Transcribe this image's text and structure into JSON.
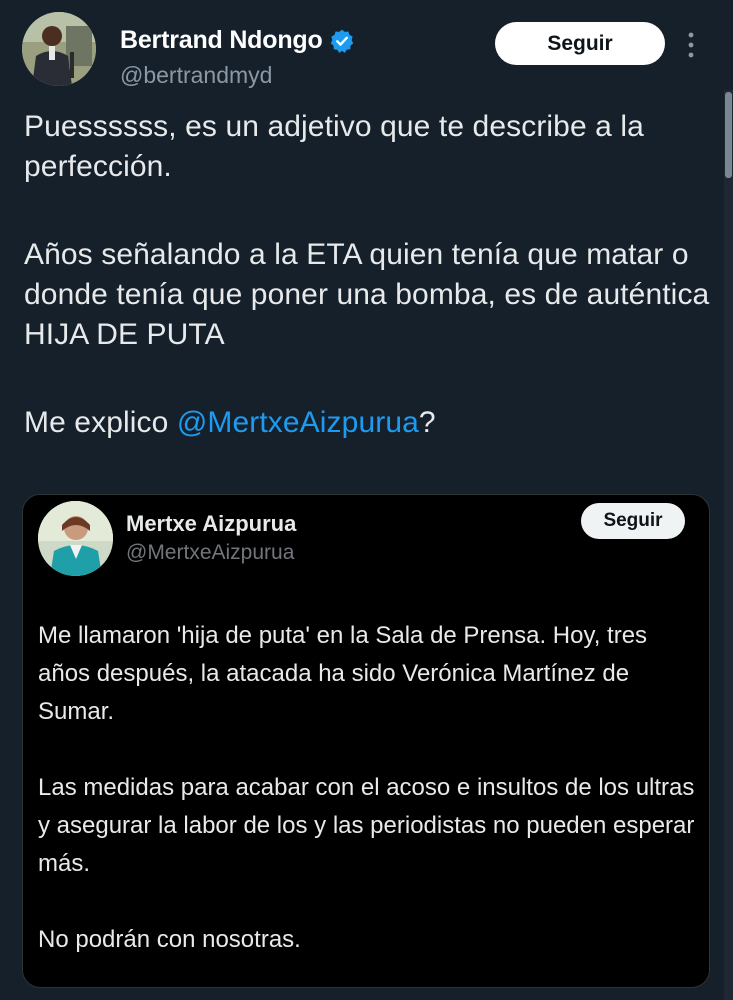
{
  "tweet": {
    "author_name": "Bertrand Ndongo",
    "author_handle": "@bertrandmyd",
    "follow_label": "Seguir",
    "text": {
      "paragraph1": "Puessssss, es un adjetivo que te describe a la perfección.",
      "paragraph2": "Años señalando a la ETA quien tenía que matar o donde tenía que poner una bomba, es de auténtica HIJA DE PUTA",
      "paragraph3_prefix": "Me explico ",
      "paragraph3_mention": "@MertxeAizpurua",
      "paragraph3_suffix": "?"
    }
  },
  "quote": {
    "author_name": "Mertxe Aizpurua",
    "author_handle": "@MertxeAizpurua",
    "follow_label": "Seguir",
    "text": {
      "paragraph1": "Me llamaron 'hija de puta' en la Sala de Prensa. Hoy, tres años después, la atacada ha sido Verónica Martínez de Sumar.",
      "paragraph2": "Las medidas para acabar con el acoso e insultos de los ultras y asegurar la labor de los y las periodistas no pueden esperar más.",
      "paragraph3": "No podrán con nosotras."
    }
  },
  "icons": {
    "verified": "verified-badge-icon",
    "more": "more-options-icon"
  },
  "colors": {
    "background": "#15202b",
    "quote_background": "#000000",
    "mention": "#1d9bf0",
    "verified": "#1d9bf0",
    "handle": "#8b98a5"
  }
}
